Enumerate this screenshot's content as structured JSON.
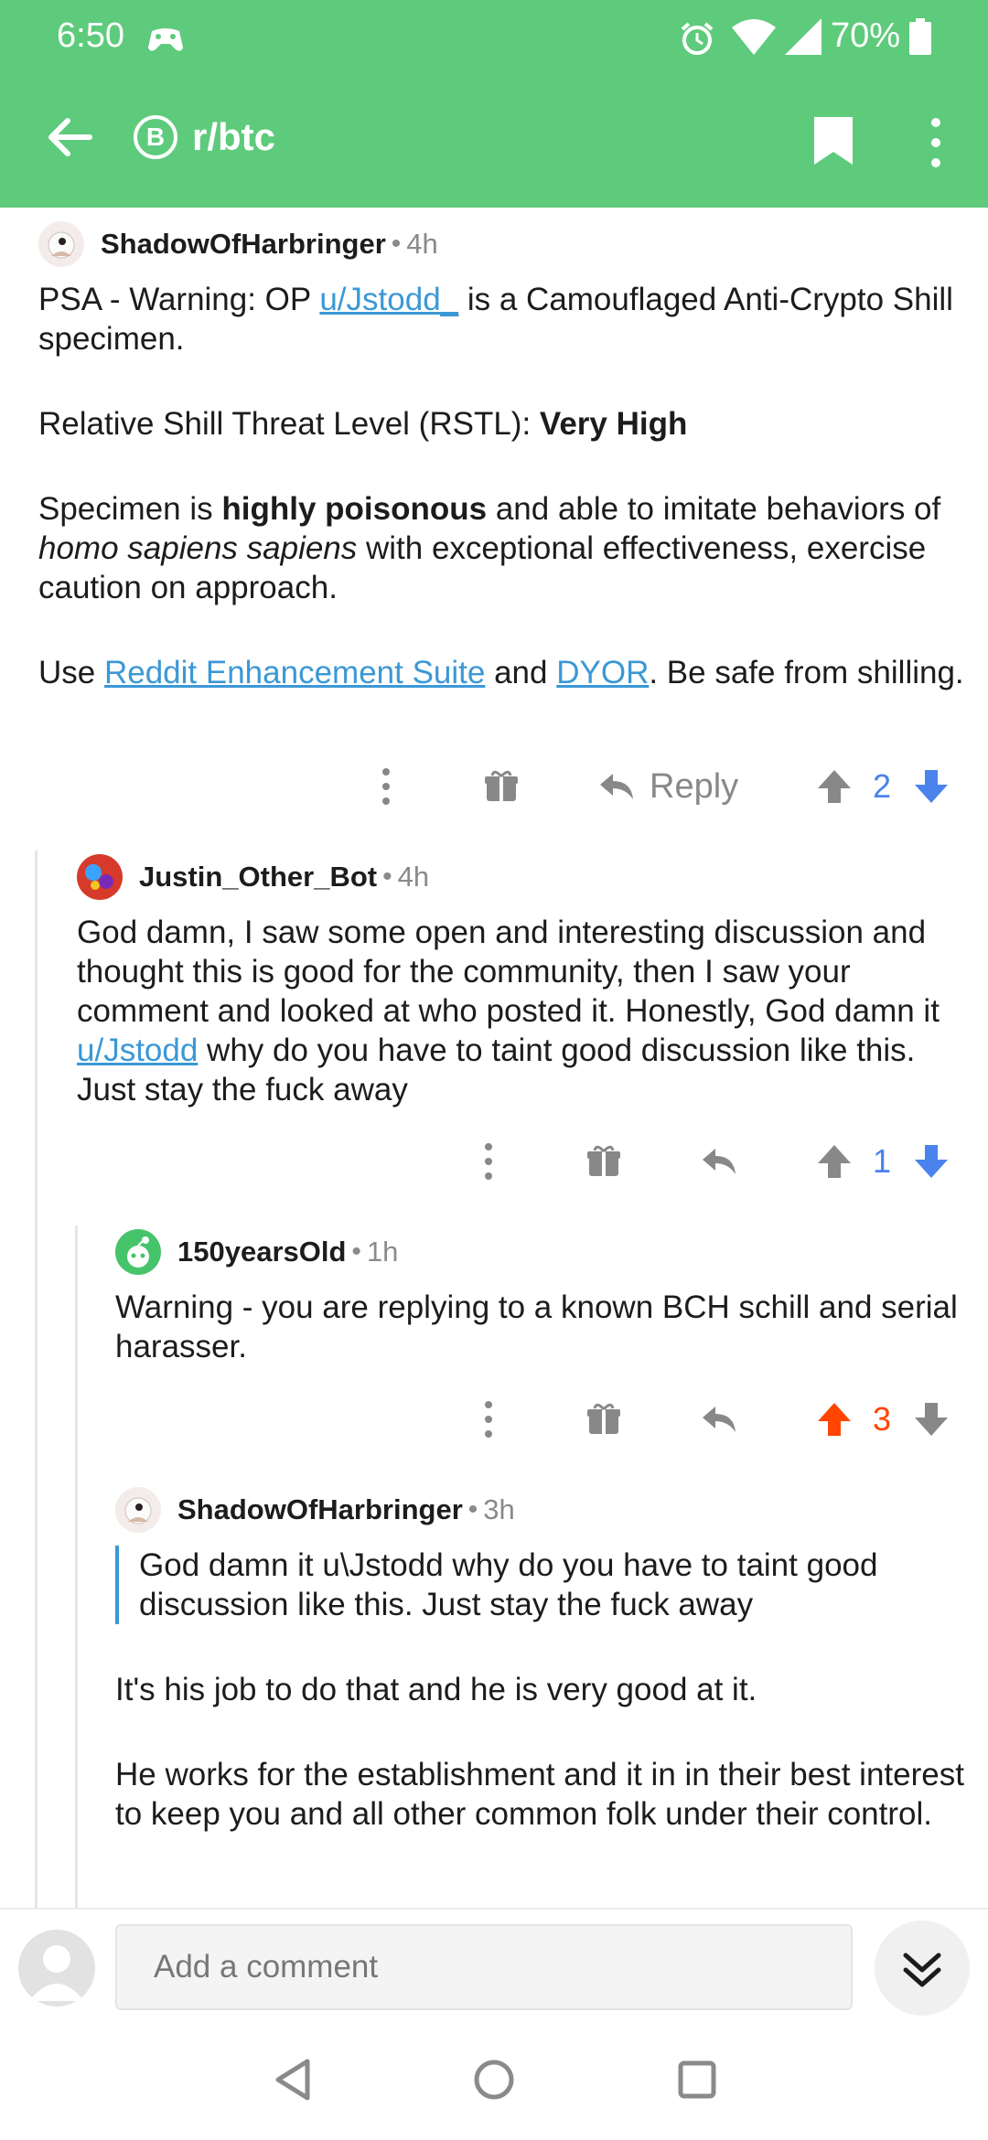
{
  "status_bar": {
    "time": "6:50",
    "battery": "70%"
  },
  "app_bar": {
    "subreddit": "r/btc",
    "badge_symbol": "B"
  },
  "comments": [
    {
      "author": "ShadowOfHarbringer",
      "age": "4h",
      "p1_a": "PSA - Warning: OP ",
      "p1_link": "u/Jstodd_",
      "p1_b": " is a Camouflaged Anti-Crypto Shill specimen.",
      "p2_a": "Relative Shill Threat Level (RSTL): ",
      "p2_bold": "Very High",
      "p3_a": "Specimen is ",
      "p3_bold": "highly poisonous",
      "p3_b": " and able to imitate behaviors of ",
      "p3_italic": "homo sapiens sapiens",
      "p3_c": " with exceptional effectiveness, exercise caution on approach.",
      "p4_a": "Use ",
      "p4_link1": "Reddit Enhancement Suite",
      "p4_b": " and ",
      "p4_link2": "DYOR",
      "p4_c": ". Be safe from shilling.",
      "reply_label": "Reply",
      "score": "2",
      "vote": "none"
    },
    {
      "author": "Justin_Other_Bot",
      "age": "4h",
      "p1_a": "God damn, I saw some open and interesting discussion and thought this is good for the community, then I saw your comment and looked at who posted it. Honestly, God damn it ",
      "p1_link": "u/Jstodd",
      "p1_b": " why do you have to taint good discussion like this. Just stay the fuck away",
      "score": "1",
      "vote": "none"
    },
    {
      "author": "150yearsOld",
      "age": "1h",
      "p1": "Warning - you are replying to a known BCH schill and serial harasser.",
      "score": "3",
      "vote": "up"
    },
    {
      "author": "ShadowOfHarbringer",
      "age": "3h",
      "quote": "God damn it u\\Jstodd why do you have to taint good discussion like this. Just stay the fuck away",
      "p1": "It's his job to do that and he is very good at it.",
      "p2": "He works for the establishment and it in in their best interest to keep you and all other common folk under their control."
    }
  ],
  "composer": {
    "placeholder": "Add a comment"
  },
  "colors": {
    "app_bar": "#5ecb7c",
    "link": "#3b98d6",
    "upvote": "#ff4500",
    "downvote_active": "#4a83ec",
    "score_blue": "#4a83ec"
  },
  "icons": [
    "back-arrow-icon",
    "bookmark-icon",
    "overflow-menu-icon",
    "gift-icon",
    "reply-icon",
    "upvote-icon",
    "downvote-icon",
    "collapse-chevron-icon"
  ]
}
